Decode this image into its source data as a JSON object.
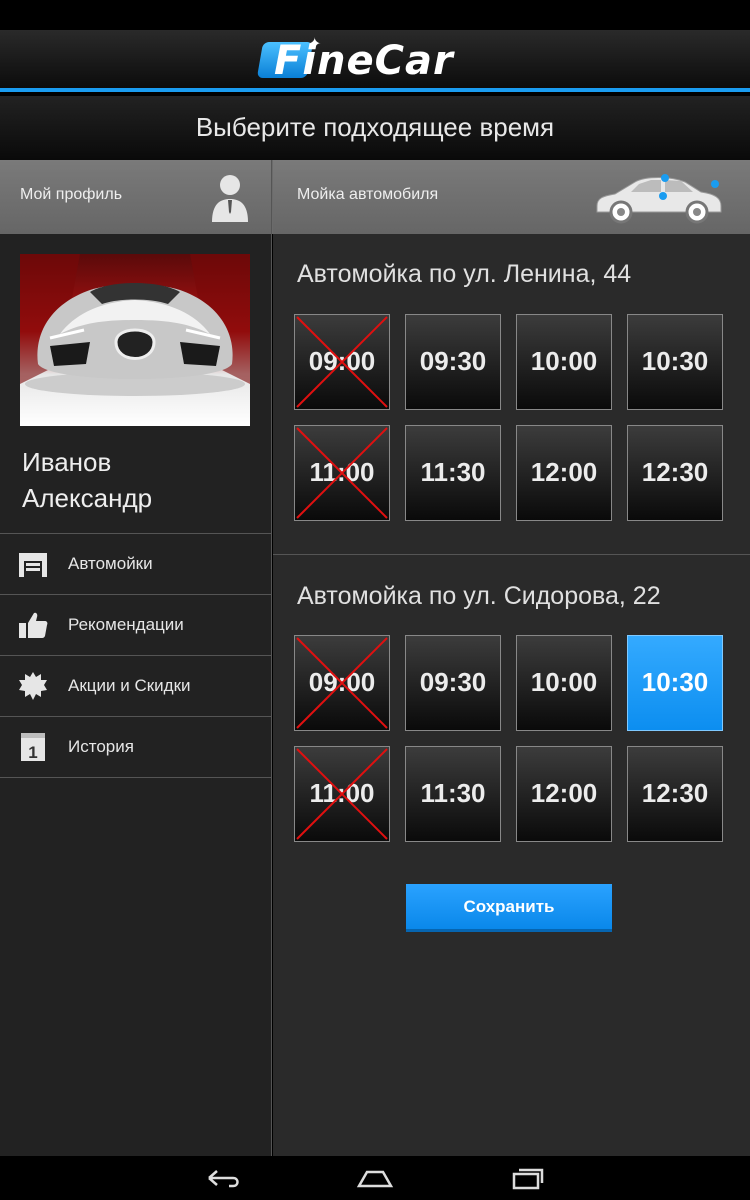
{
  "app": {
    "logo_text": "FineCar"
  },
  "header": {
    "title": "Выберите подходящее время"
  },
  "tabs": {
    "profile_label": "Мой профиль",
    "wash_label": "Мойка автомобиля"
  },
  "profile": {
    "name_line1": "Иванов",
    "name_line2": "Александр"
  },
  "sidebar": {
    "items": [
      {
        "label": "Автомойки",
        "icon": "garage-icon"
      },
      {
        "label": "Рекомендации",
        "icon": "thumbs-up-icon"
      },
      {
        "label": "Акции и Скидки",
        "icon": "starburst-icon"
      },
      {
        "label": "История",
        "icon": "calendar-icon"
      }
    ]
  },
  "washes": [
    {
      "title": "Автомойка по ул. Ленина, 44",
      "slots": [
        {
          "time": "09:00",
          "state": "unavailable"
        },
        {
          "time": "09:30",
          "state": "available"
        },
        {
          "time": "10:00",
          "state": "available"
        },
        {
          "time": "10:30",
          "state": "available"
        },
        {
          "time": "11:00",
          "state": "unavailable"
        },
        {
          "time": "11:30",
          "state": "available"
        },
        {
          "time": "12:00",
          "state": "available"
        },
        {
          "time": "12:30",
          "state": "available"
        }
      ]
    },
    {
      "title": "Автомойка по ул. Сидорова, 22",
      "slots": [
        {
          "time": "09:00",
          "state": "unavailable"
        },
        {
          "time": "09:30",
          "state": "available"
        },
        {
          "time": "10:00",
          "state": "available"
        },
        {
          "time": "10:30",
          "state": "selected"
        },
        {
          "time": "11:00",
          "state": "unavailable"
        },
        {
          "time": "11:30",
          "state": "available"
        },
        {
          "time": "12:00",
          "state": "available"
        },
        {
          "time": "12:30",
          "state": "available"
        }
      ]
    }
  ],
  "actions": {
    "save_label": "Сохранить"
  },
  "colors": {
    "accent": "#1a9cf0",
    "selected": "#1e9bff",
    "unavailable_cross": "#e01010"
  }
}
